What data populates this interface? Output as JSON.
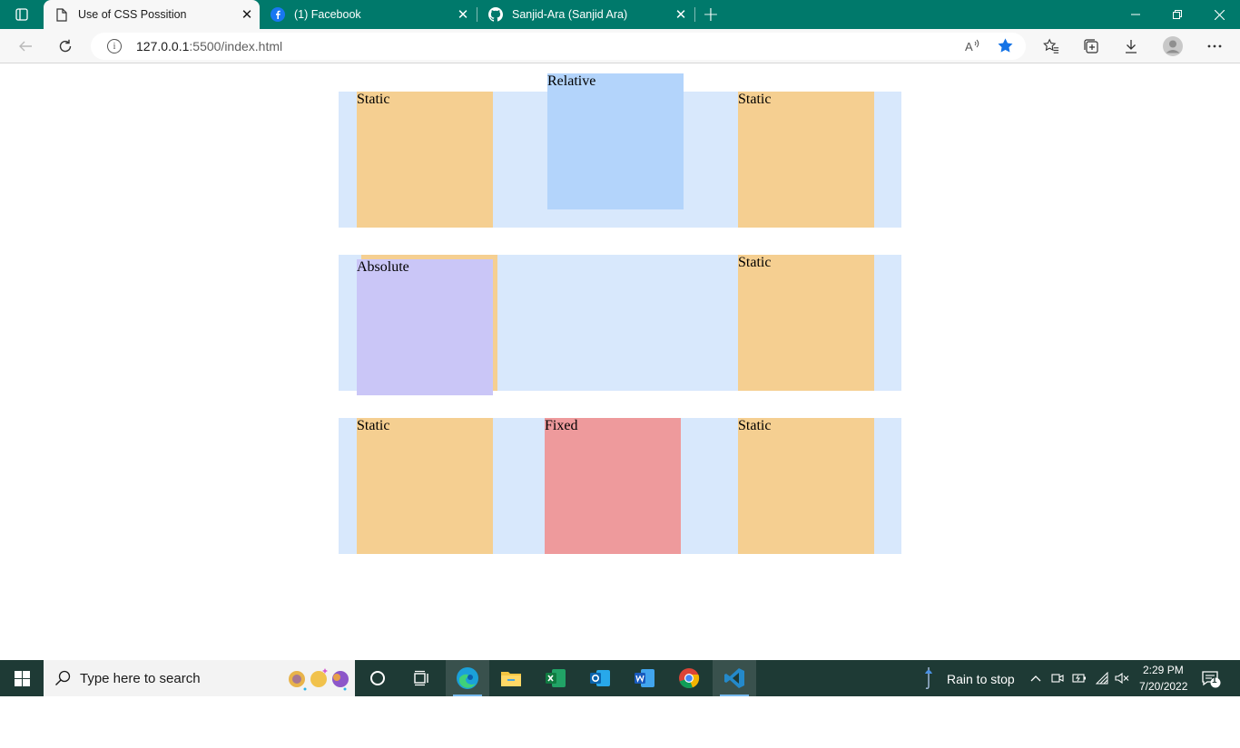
{
  "browser": {
    "tabs": [
      {
        "title": "Use of CSS Possition",
        "close": "✕"
      },
      {
        "title": "(1) Facebook",
        "close": "✕"
      },
      {
        "title": "Sanjid-Ara (Sanjid Ara)",
        "close": "✕"
      }
    ],
    "new_tab": "+",
    "address": {
      "info": "i",
      "host": "127.0.0.1",
      "path": ":5500/index.html"
    }
  },
  "page": {
    "rows": [
      {
        "boxes": [
          {
            "label": "Static",
            "type": "static"
          },
          {
            "label": "Relative",
            "type": "relative"
          },
          {
            "label": "Static",
            "type": "static"
          }
        ]
      },
      {
        "boxes": [
          {
            "label": "Absolute",
            "type": "absolute"
          },
          {
            "label": "Static",
            "type": "static"
          }
        ]
      },
      {
        "boxes": [
          {
            "label": "Static",
            "type": "static"
          },
          {
            "label": "Fixed",
            "type": "fixed"
          },
          {
            "label": "Static",
            "type": "static"
          }
        ]
      }
    ]
  },
  "colors": {
    "static": "#f5cf91",
    "relative": "#b3d4fb",
    "absolute": "#cac6f7",
    "fixed": "#ee9a9c",
    "row_bg": "#d8e8fc",
    "tabstrip": "#00796b"
  },
  "taskbar": {
    "search_placeholder": "Type here to search",
    "weather": "Rain to stop",
    "time": "2:29 PM",
    "date": "7/20/2022",
    "notification_count": "1",
    "apps": [
      "cortana-icon",
      "task-view-icon",
      "edge-icon",
      "file-explorer-icon",
      "excel-icon",
      "outlook-icon",
      "word-icon",
      "chrome-icon",
      "vscode-icon"
    ]
  }
}
